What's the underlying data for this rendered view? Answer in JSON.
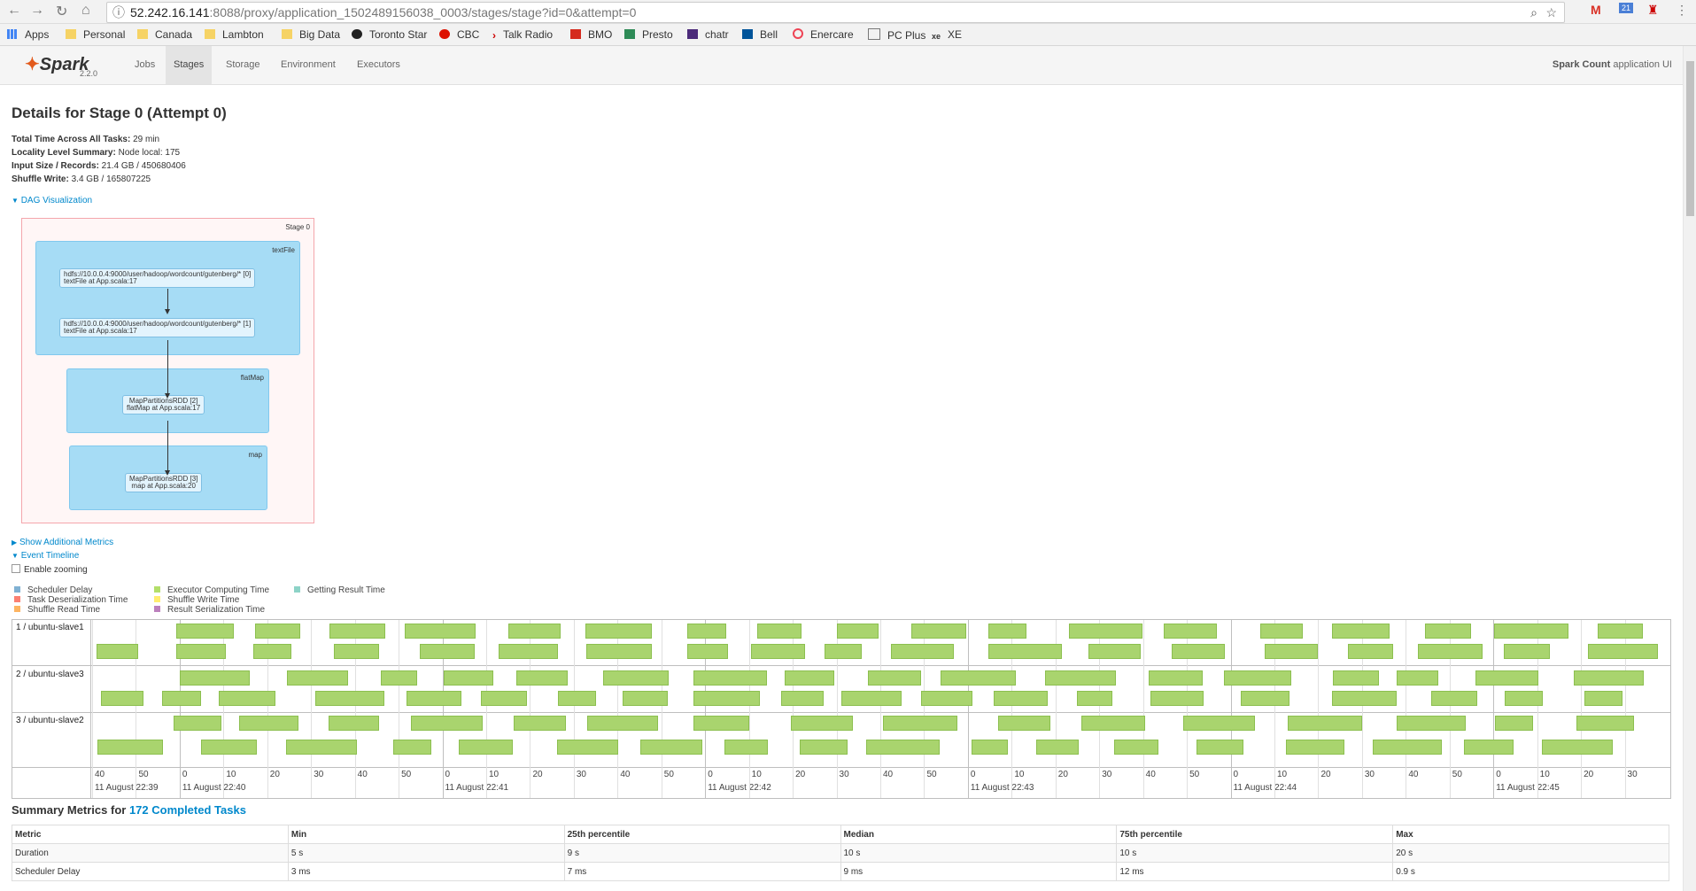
{
  "browser": {
    "url_host": "52.242.16.141",
    "url_path": ":8088/proxy/application_1502489156038_0003/stages/stage?id=0&attempt=0"
  },
  "bookmarks": [
    "Apps",
    "Personal",
    "Canada",
    "Lambton",
    "Big Data",
    "Toronto Star",
    "CBC",
    "Talk Radio",
    "BMO",
    "Presto",
    "chatr",
    "Bell",
    "Enercare",
    "PC Plus",
    "XE"
  ],
  "nav": {
    "version": "2.2.0",
    "tabs": [
      "Jobs",
      "Stages",
      "Storage",
      "Environment",
      "Executors"
    ],
    "active_tab": "Stages",
    "app_name_bold": "Spark Count",
    "app_name_suffix": " application UI"
  },
  "page": {
    "title": "Details for Stage 0 (Attempt 0)",
    "summary": [
      {
        "label": "Total Time Across All Tasks:",
        "value": " 29 min"
      },
      {
        "label": "Locality Level Summary:",
        "value": " Node local: 175"
      },
      {
        "label": "Input Size / Records:",
        "value": " 21.4 GB / 450680406"
      },
      {
        "label": "Shuffle Write:",
        "value": " 3.4 GB / 165807225"
      }
    ],
    "dag_toggle": "DAG Visualization",
    "additional_metrics": "Show Additional Metrics",
    "event_timeline": "Event Timeline",
    "enable_zooming": "Enable zooming"
  },
  "dag": {
    "stage_label": "Stage 0",
    "clusters": [
      {
        "label": "textFile",
        "nodes": [
          {
            "line1": "hdfs://10.0.0.4:9000/user/hadoop/wordcount/gutenberg/* [0]",
            "line2": "textFile at App.scala:17"
          },
          {
            "line1": "hdfs://10.0.0.4:9000/user/hadoop/wordcount/gutenberg/* [1]",
            "line2": "textFile at App.scala:17"
          }
        ]
      },
      {
        "label": "flatMap",
        "nodes": [
          {
            "line1": "MapPartitionsRDD [2]",
            "line2": "flatMap at App.scala:17"
          }
        ]
      },
      {
        "label": "map",
        "nodes": [
          {
            "line1": "MapPartitionsRDD [3]",
            "line2": "map at App.scala:20"
          }
        ]
      }
    ]
  },
  "legend": [
    {
      "label": "Scheduler Delay",
      "color": "#80b1d3"
    },
    {
      "label": "Task Deserialization Time",
      "color": "#fb8072"
    },
    {
      "label": "Shuffle Read Time",
      "color": "#fdb462"
    },
    {
      "label": "Executor Computing Time",
      "color": "#b3de69"
    },
    {
      "label": "Shuffle Write Time",
      "color": "#ffed6f"
    },
    {
      "label": "Result Serialization Time",
      "color": "#bc80bd"
    },
    {
      "label": "Getting Result Time",
      "color": "#8dd3c7"
    }
  ],
  "timeline": {
    "executors": [
      "1 / ubuntu-slave1",
      "2 / ubuntu-slave3",
      "3 / ubuntu-slave2"
    ],
    "tick_labels": [
      "40",
      "50",
      "0",
      "10",
      "20",
      "30",
      "40",
      "50",
      "0",
      "10",
      "20",
      "30",
      "40",
      "50",
      "0",
      "10",
      "20",
      "30",
      "40",
      "50",
      "0",
      "10",
      "20",
      "30",
      "40",
      "50",
      "0",
      "10",
      "20",
      "30",
      "40",
      "50",
      "0",
      "10",
      "20",
      "30"
    ],
    "minute_labels": [
      "11 August 22:39",
      "11 August 22:40",
      "11 August 22:41",
      "11 August 22:42",
      "11 August 22:43",
      "11 August 22:44",
      "11 August 22:45"
    ]
  },
  "summary_metrics": {
    "heading_prefix": "Summary Metrics for ",
    "heading_link": "172 Completed Tasks",
    "columns": [
      "Metric",
      "Min",
      "25th percentile",
      "Median",
      "75th percentile",
      "Max"
    ],
    "rows": [
      [
        "Duration",
        "5 s",
        "9 s",
        "10 s",
        "10 s",
        "20 s"
      ],
      [
        "Scheduler Delay",
        "3 ms",
        "7 ms",
        "9 ms",
        "12 ms",
        "0.9 s"
      ]
    ]
  }
}
